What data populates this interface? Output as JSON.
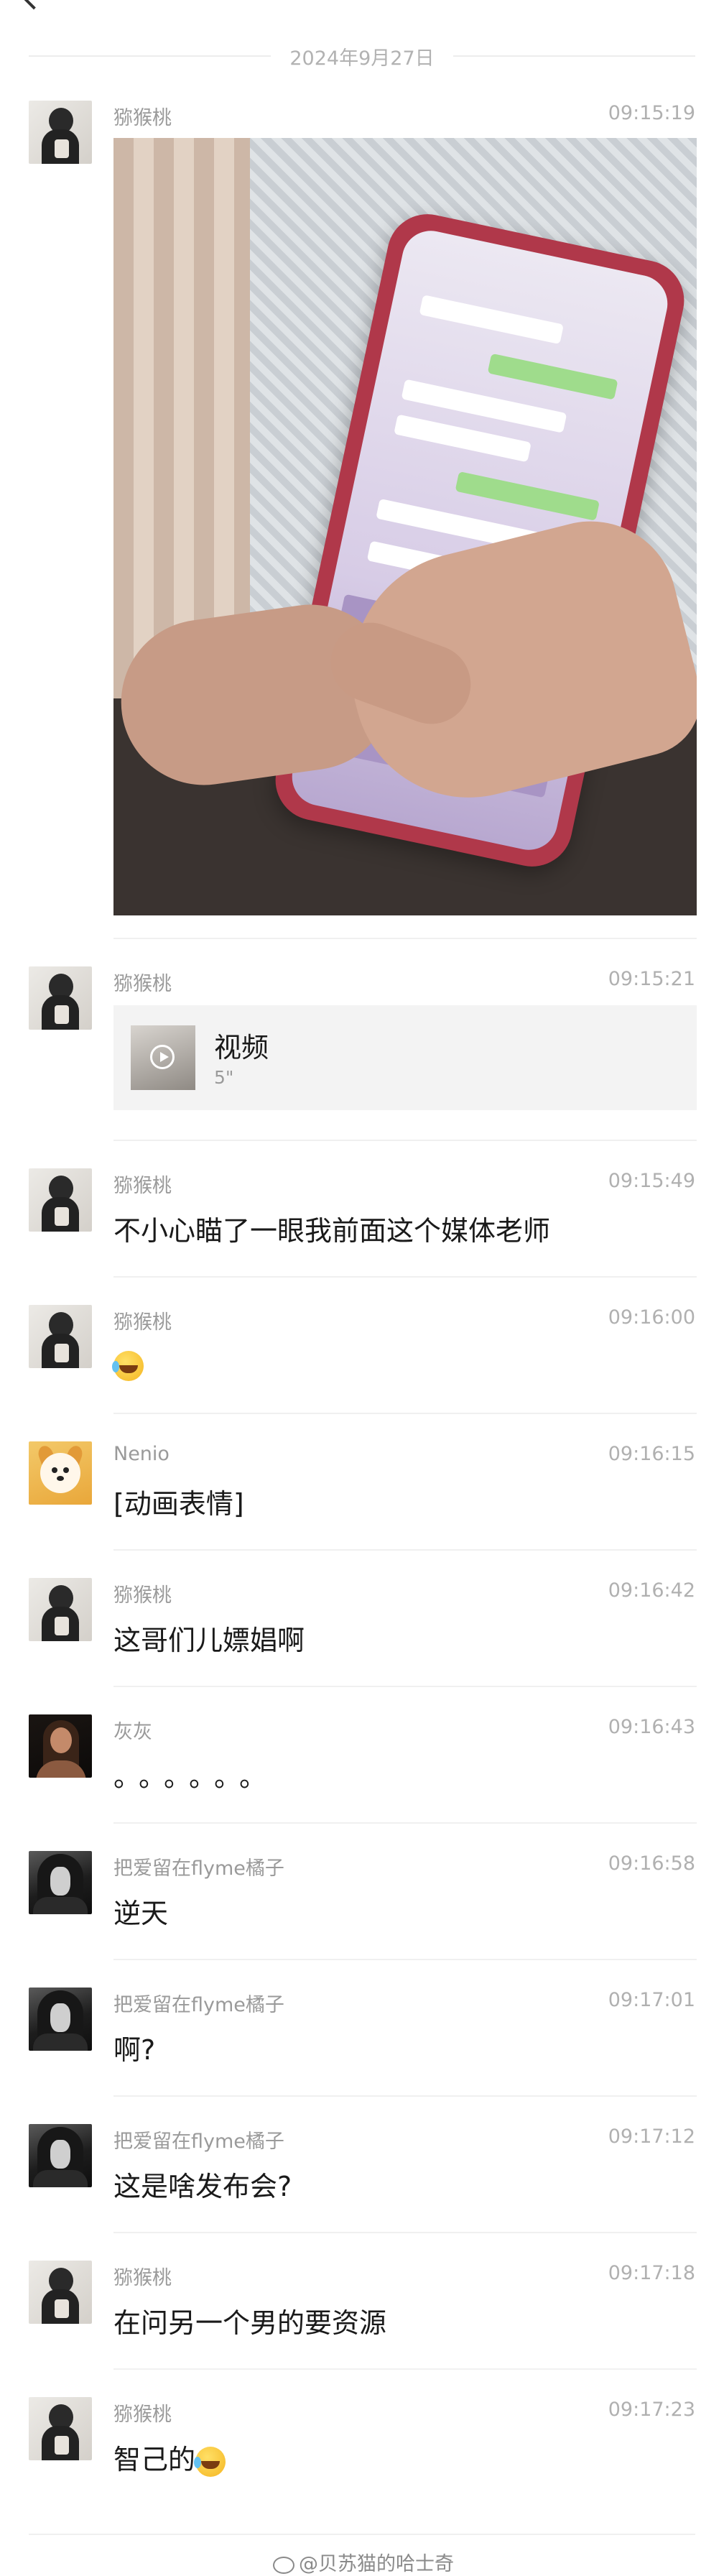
{
  "date_label": "2024年9月27日",
  "messages": [
    {
      "sender": "猕猴桃",
      "time": "09:15:19",
      "type": "image"
    },
    {
      "sender": "猕猴桃",
      "time": "09:15:21",
      "type": "video",
      "video_title": "视频",
      "video_duration": "5\""
    },
    {
      "sender": "猕猴桃",
      "time": "09:15:49",
      "text": "不小心瞄了一眼我前面这个媒体老师"
    },
    {
      "sender": "猕猴桃",
      "time": "09:16:00",
      "type": "emoji",
      "emoji": "laugh-cry"
    },
    {
      "sender": "Nenio",
      "time": "09:16:15",
      "text": "[动画表情]"
    },
    {
      "sender": "猕猴桃",
      "time": "09:16:42",
      "text": "这哥们儿嫖娼啊"
    },
    {
      "sender": "灰灰",
      "time": "09:16:43",
      "text": "。。。。。。"
    },
    {
      "sender": "把爱留在flyme橘子",
      "time": "09:16:58",
      "text": "逆天"
    },
    {
      "sender": "把爱留在flyme橘子",
      "time": "09:17:01",
      "text": "啊?"
    },
    {
      "sender": "把爱留在flyme橘子",
      "time": "09:17:12",
      "text": "这是啥发布会?"
    },
    {
      "sender": "猕猴桃",
      "time": "09:17:18",
      "text": "在问另一个男的要资源"
    },
    {
      "sender": "猕猴桃",
      "time": "09:17:23",
      "text": "智己的"
    }
  ],
  "watermark": "@贝苏猫的哈士奇"
}
